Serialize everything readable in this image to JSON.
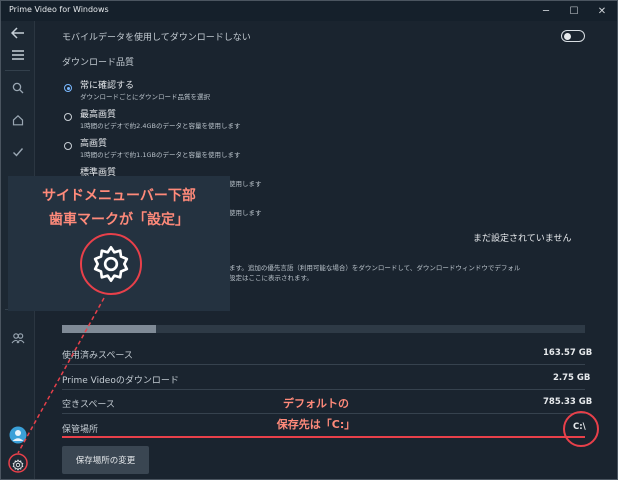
{
  "window": {
    "title": "Prime Video for Windows",
    "controls": {
      "minimize": "─",
      "maximize": "☐",
      "close": "✕"
    }
  },
  "sidebar": {
    "icons": [
      "back-arrow-icon",
      "menu-icon",
      "search-icon",
      "home-icon",
      "check-icon",
      "profile-group-icon",
      "user-avatar-icon",
      "gear-icon"
    ]
  },
  "settings": {
    "mobile_data": {
      "label": "モバイルデータを使用してダウンロードしない",
      "toggle_on": false
    },
    "quality": {
      "heading": "ダウンロード品質",
      "options": [
        {
          "label": "常に確認する",
          "desc": "ダウンロードごとにダウンロード品質を選択",
          "selected": true
        },
        {
          "label": "最高画質",
          "desc": "1時間のビデオで約2.4GBのデータと容量を使用します",
          "selected": false
        },
        {
          "label": "高画質",
          "desc": "1時間のビデオで約1.1GBのデータと容量を使用します",
          "selected": false
        },
        {
          "label": "標準画質",
          "desc": "使用します",
          "selected": false
        },
        {
          "label": "",
          "desc": "使用します",
          "selected": false
        }
      ]
    },
    "audio": {
      "value": "まだ設定されていません",
      "desc_line1": "ます。追加の優先言語（利用可能な場合）をダウンロードして、ダウンロードウィンドウでデフォル",
      "desc_line2": "設定はここに表示されます。"
    },
    "storage": {
      "used_fraction": 0.18,
      "rows": [
        {
          "label": "使用済みスペース",
          "value": "163.57 GB"
        },
        {
          "label": "Prime Videoのダウンロード",
          "value": "2.75 GB"
        },
        {
          "label": "空きスペース",
          "value": "785.33 GB"
        },
        {
          "label": "保管場所",
          "value": "C:\\"
        }
      ],
      "change_button": "保存場所の変更"
    }
  },
  "annotations": {
    "callout_line1": "サイドメニューバー下部",
    "callout_line2": "歯車マークが「設定」",
    "default_line1": "デフォルトの",
    "default_line2": "保存先は「C:」",
    "accent_color": "#e8404a"
  }
}
